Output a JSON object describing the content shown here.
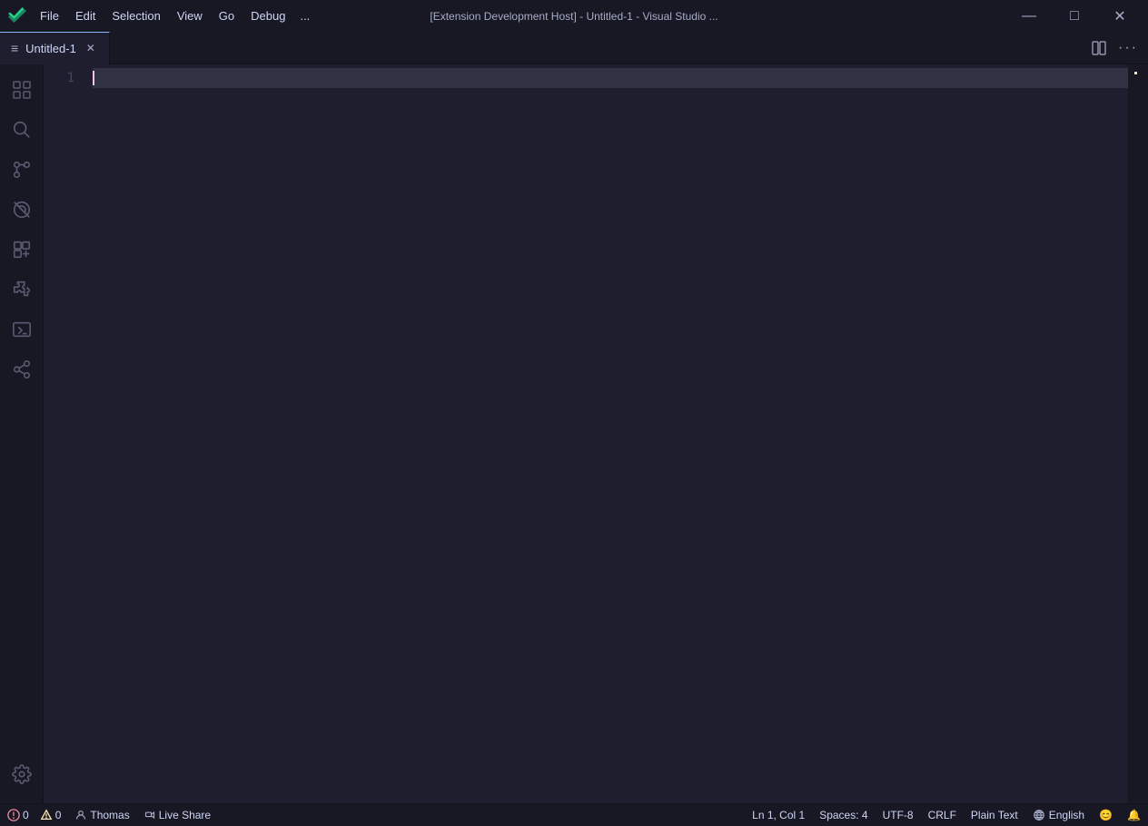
{
  "titlebar": {
    "logo_label": "VS Code",
    "menu": [
      "File",
      "Edit",
      "Selection",
      "View",
      "Go",
      "Debug",
      "..."
    ],
    "title": "[Extension Development Host] - Untitled-1 - Visual Studio ...",
    "minimize": "—",
    "maximize": "□",
    "close": "✕"
  },
  "tabs": {
    "active_tab": {
      "icon": "≡",
      "name": "Untitled-1",
      "close": "✕"
    }
  },
  "tabsbar_actions": {
    "split": "⊞",
    "more": "···"
  },
  "activity": {
    "items": [
      {
        "icon": "explorer",
        "label": "Explorer"
      },
      {
        "icon": "search",
        "label": "Search"
      },
      {
        "icon": "source-control",
        "label": "Source Control"
      },
      {
        "icon": "no-wifi",
        "label": "Remote"
      },
      {
        "icon": "extensions",
        "label": "Extensions"
      },
      {
        "icon": "puzzle",
        "label": "Puzzle"
      },
      {
        "icon": "terminal",
        "label": "Terminal"
      },
      {
        "icon": "share",
        "label": "Share"
      }
    ],
    "bottom_item": {
      "icon": "gear",
      "label": "Settings"
    }
  },
  "editor": {
    "line_number": "1",
    "line_content": ""
  },
  "statusbar": {
    "errors": "0",
    "warnings": "0",
    "user": "Thomas",
    "liveshare": "Live Share",
    "position": "Ln 1, Col 1",
    "spaces": "Spaces: 4",
    "encoding": "UTF-8",
    "eol": "CRLF",
    "language": "Plain Text",
    "language_icon": "🌐",
    "english": "English",
    "smiley": "😊",
    "bell": "🔔"
  }
}
